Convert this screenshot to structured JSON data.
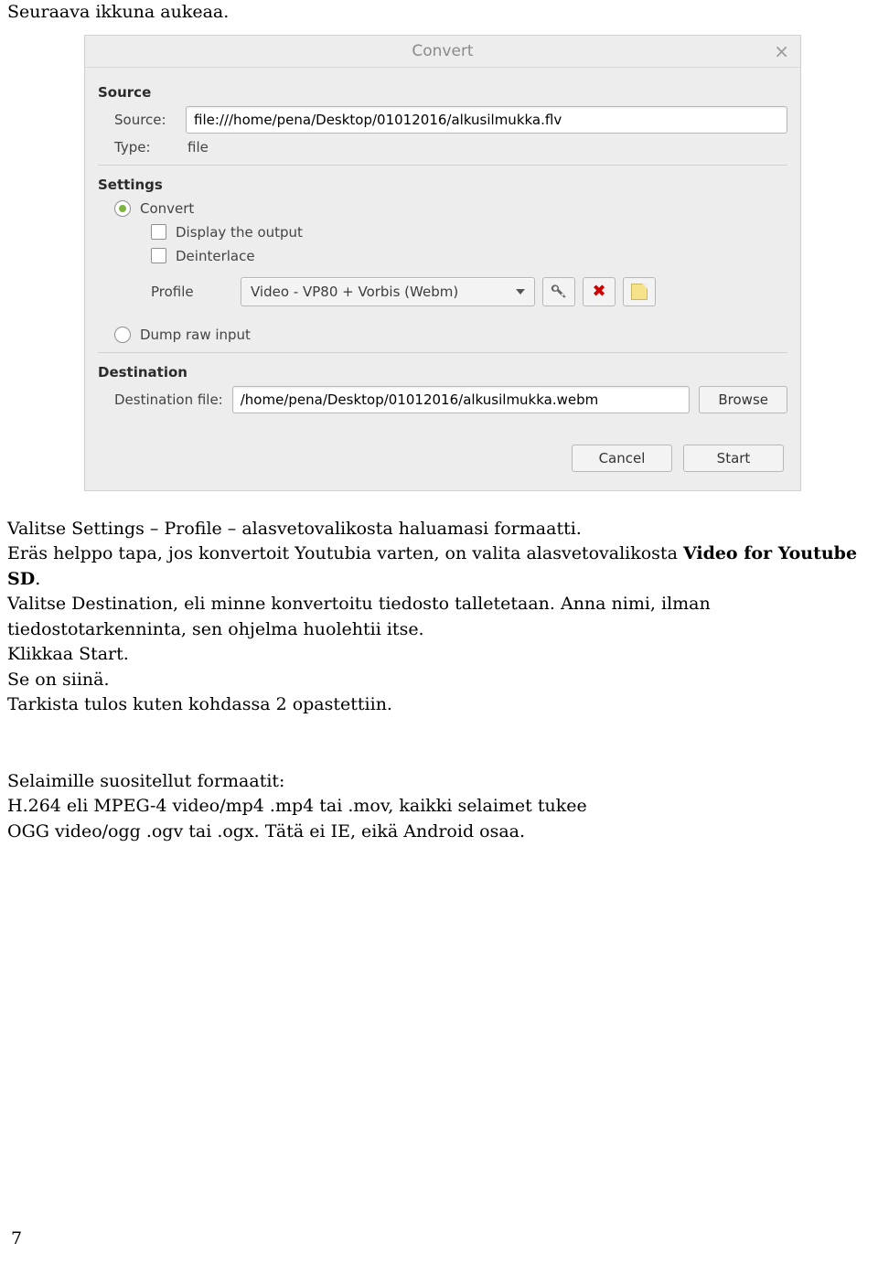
{
  "doc": {
    "intro": "Seuraava ikkuna aukeaa.",
    "para1": "Valitse Settings – Profile – alasvetovalikosta haluamasi formaatti.",
    "para2a": "Eräs helppo tapa, jos konvertoit Youtubia varten, on valita alasvetovalikosta ",
    "para2b": "Video for Youtube SD",
    "para2c": ".",
    "para3": "Valitse Destination, eli minne konvertoitu tiedosto talletetaan. Anna nimi, ilman tiedostotarkenninta, sen ohjelma huolehtii itse.",
    "para4": "Klikkaa Start.",
    "para5": "Se on siinä.",
    "para6": "Tarkista tulos kuten kohdassa 2 opastettiin.",
    "formats_head": "Selaimille suositellut formaatit:",
    "formats_1": "H.264 eli MPEG-4 video/mp4 .mp4 tai .mov, kaikki selaimet tukee",
    "formats_2": "OGG video/ogg .ogv tai .ogx. Tätä ei IE, eikä Android osaa.",
    "page_number": "7"
  },
  "win": {
    "title": "Convert",
    "close": "×",
    "source_section": "Source",
    "source_label": "Source:",
    "source_value": "file:///home/pena/Desktop/01012016/alkusilmukka.flv",
    "type_label": "Type:",
    "type_value": "file",
    "settings_section": "Settings",
    "radio_convert": "Convert",
    "check_display": "Display the output",
    "check_deinterlace": "Deinterlace",
    "profile_label": "Profile",
    "profile_value": "Video - VP80 + Vorbis (Webm)",
    "radio_dump": "Dump raw input",
    "dest_section": "Destination",
    "dest_label": "Destination file:",
    "dest_value": "/home/pena/Desktop/01012016/alkusilmukka.webm",
    "browse": "Browse",
    "cancel": "Cancel",
    "start": "Start"
  }
}
